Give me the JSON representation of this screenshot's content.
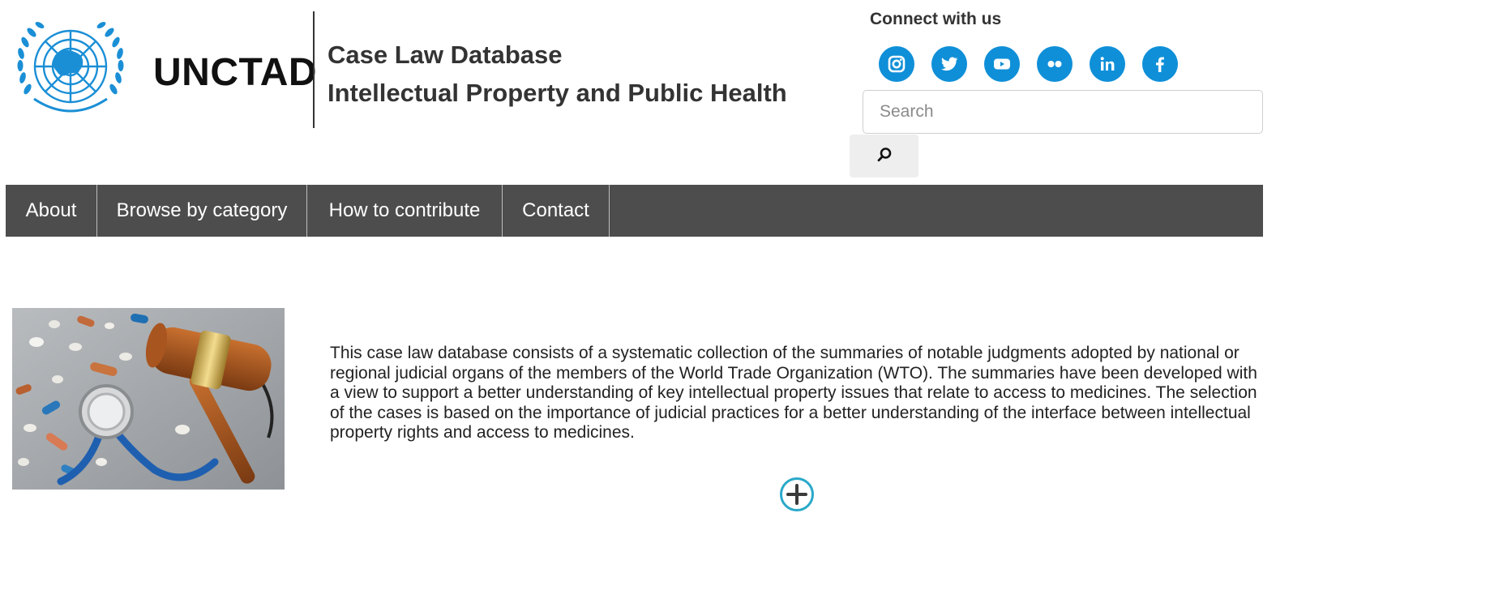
{
  "header": {
    "logo_text": "UNCTAD",
    "title_line1": "Case Law Database",
    "title_line2": "Intellectual Property and Public Health"
  },
  "social": {
    "label": "Connect with us",
    "icons": [
      "instagram-icon",
      "twitter-icon",
      "youtube-icon",
      "flickr-icon",
      "linkedin-icon",
      "facebook-icon"
    ],
    "color": "#0f8fd8"
  },
  "search": {
    "placeholder": "Search",
    "value": "",
    "button_icon": "search-icon"
  },
  "nav": {
    "background": "#4d4d4d",
    "items": [
      {
        "label": "About"
      },
      {
        "label": "Browse by category"
      },
      {
        "label": "How to contribute"
      },
      {
        "label": "Contact"
      }
    ]
  },
  "main": {
    "image_icon": "gavel-stethoscope-pills-photo",
    "intro": "This case law database consists of a systematic collection of the summaries of notable judgments adopted by national or regional judicial organs of the members of the World Trade Organization (WTO). The summaries have been developed with a view to support a better understanding of key intellectual property issues that relate to access to medicines.  The selection of the cases is based on the importance of judicial practices for a better understanding of the interface between intellectual property rights and access to medicines.",
    "expand_icon": "plus-circle-icon"
  }
}
